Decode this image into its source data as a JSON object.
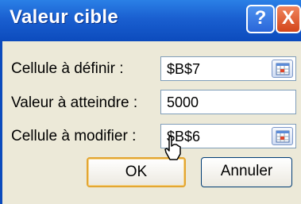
{
  "dialog": {
    "title": "Valeur cible",
    "help_glyph": "?",
    "close_glyph": "X"
  },
  "fields": {
    "set_cell": {
      "label": "Cellule à définir :",
      "value": "$B$7",
      "icon": "range-select-icon"
    },
    "target_value": {
      "label": "Valeur à atteindre :",
      "value": "5000"
    },
    "change_cell": {
      "label": "Cellule à modifier :",
      "value": "$B$6",
      "icon": "range-select-icon"
    }
  },
  "buttons": {
    "ok": "OK",
    "cancel": "Annuler"
  },
  "colors": {
    "titlebar": "#1a5fd0",
    "close": "#d3461b",
    "dialog_bg": "#ece9d8",
    "ok_focus": "#e3a632"
  }
}
